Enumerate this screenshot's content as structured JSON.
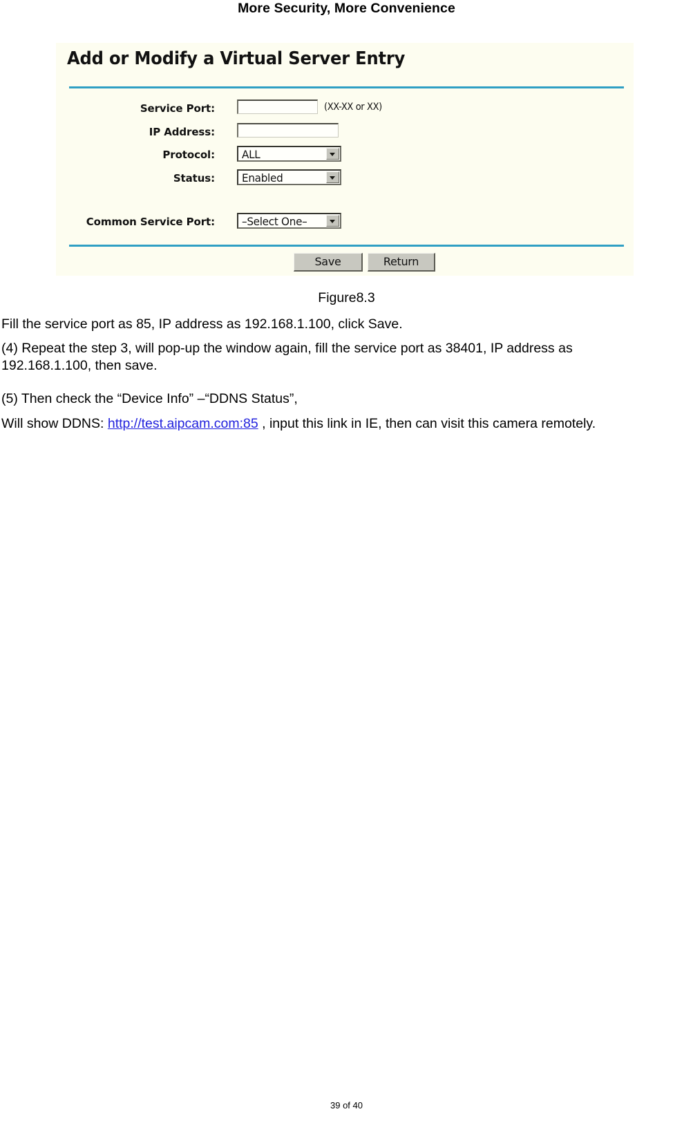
{
  "page": {
    "header_title": "More Security, More Convenience",
    "footer": "39 of 40"
  },
  "figure": {
    "caption": "Figure8.3",
    "panel": {
      "title": "Add or Modify a Virtual Server Entry",
      "fields": [
        {
          "label": "Service Port:",
          "type": "text",
          "value": "",
          "hint": "(XX-XX or XX)"
        },
        {
          "label": "IP Address:",
          "type": "text",
          "value": "",
          "hint": ""
        },
        {
          "label": "Protocol:",
          "type": "select",
          "value": "ALL",
          "hint": ""
        },
        {
          "label": "Status:",
          "type": "select",
          "value": "Enabled",
          "hint": ""
        },
        {
          "label": "Common Service Port:",
          "type": "select",
          "value": "–Select One–",
          "hint": ""
        }
      ],
      "buttons": {
        "save": "Save",
        "return": "Return"
      },
      "colors": {
        "panel_background": "#fdfdf0",
        "divider": "#2f9fc4",
        "button_face": "#c8c8c0"
      }
    }
  },
  "body": {
    "p1": "Fill the service port as 85, IP address as 192.168.1.100, click Save.",
    "p2_line1": "(4)   Repeat  the  step  3,  will  pop-up  the  window  again,  fill  the  service  port  as  38401,  IP  address  as",
    "p2_line2": "192.168.1.100, then save.",
    "p3": "(5)  Then check the “Device Info” –“DDNS Status”,",
    "p4_before": "Will show DDNS: ",
    "p4_link": "http://test.aipcam.com:85",
    "p4_after": " , input this link in IE, then can visit this camera remotely."
  }
}
